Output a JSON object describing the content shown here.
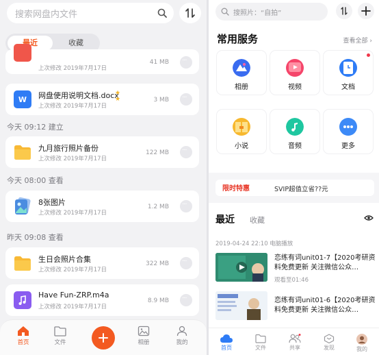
{
  "left": {
    "search_placeholder": "搜索网盘内文件",
    "tabs": {
      "recent": "最近",
      "favorites": "收藏"
    },
    "partial_card": {
      "size": "41 MB",
      "date": "上次修改 2019年7月17日"
    },
    "cards": [
      {
        "name": "网盘使用说明文档.docx",
        "date": "上次修改 2019年7月17日",
        "size": "3 MB"
      },
      {
        "name": "九月旅行照片备份",
        "date": "上次修改 2019年7月17日",
        "size": "122 MB"
      },
      {
        "name": "8张图片",
        "date": "上次修改 2019年7月17日",
        "size": "1.2 MB"
      },
      {
        "name": "生日会照片合集",
        "date": "上次修改 2019年7月17日",
        "size": "322 MB"
      },
      {
        "name": "Have Fun-ZRP.m4a",
        "date": "上次修改 2019年7月17日",
        "size": "8.9 MB"
      }
    ],
    "sections": [
      "今天 09:12 建立",
      "今天 08:00 查看",
      "昨天 09:08 查看"
    ],
    "nav": {
      "home": "首页",
      "files": "文件",
      "photos": "相册",
      "mine": "我的"
    },
    "colors": {
      "accent": "#f35a21"
    }
  },
  "right": {
    "search_placeholder": "搜照片：“自拍”",
    "services_title": "常用服务",
    "view_all": "查看全部",
    "services": [
      {
        "label": "相册"
      },
      {
        "label": "视频"
      },
      {
        "label": "文档"
      },
      {
        "label": "小说"
      },
      {
        "label": "音频"
      },
      {
        "label": "更多"
      }
    ],
    "banner": {
      "tag": "限时特惠",
      "text": "SVIP超值立省??元"
    },
    "tabs": {
      "recent": "最近",
      "favorites": "收藏"
    },
    "meta": "2019-04-24 22:10  电脑播放",
    "videos": [
      {
        "title": "恋练有词unit01-7【2020考研资料免费更新 关注微信公众…",
        "sub": "观看至01:46"
      },
      {
        "title": "恋练有词unit01-6【2020考研资料免费更新 关注微信公众…",
        "sub": ""
      }
    ],
    "nav": {
      "home": "首页",
      "files": "文件",
      "share": "共享",
      "discover": "发现",
      "mine": "我的"
    },
    "colors": {
      "accent": "#2e7cf6"
    }
  }
}
